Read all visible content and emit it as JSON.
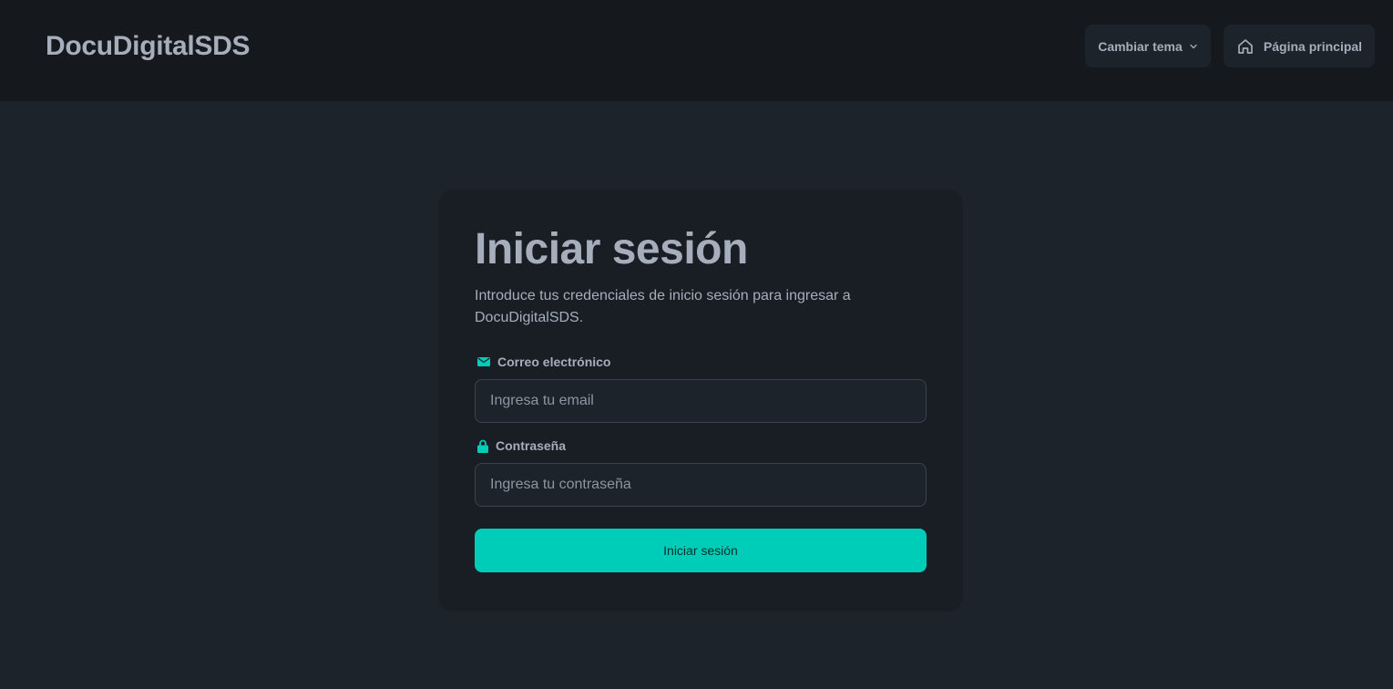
{
  "navbar": {
    "brand": "DocuDigitalSDS",
    "theme_button": {
      "label": "Cambiar tema",
      "icon": "chevron-down-icon"
    },
    "home_button": {
      "label": "Página principal",
      "icon": "home-icon"
    }
  },
  "login": {
    "title": "Iniciar sesión",
    "subtitle": "Introduce tus credenciales de inicio sesión para ingresar a DocuDigitalSDS.",
    "email": {
      "label": "Correo electrónico",
      "icon": "envelope-icon",
      "value": "",
      "placeholder": "Ingresa tu email"
    },
    "password": {
      "label": "Contraseña",
      "icon": "lock-icon",
      "value": "",
      "placeholder": "Ingresa tu contraseña"
    },
    "submit_label": "Iniciar sesión"
  },
  "colors": {
    "accent": "#00cdb7",
    "background": "#1d232a",
    "navbar": "#15191e",
    "card": "#191e24",
    "text": "#a6adbb"
  }
}
